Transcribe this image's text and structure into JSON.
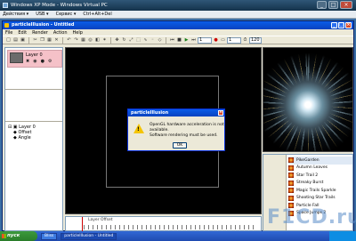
{
  "host": {
    "title": "Windows XP Mode - Windows Virtual PC",
    "menu": [
      "Действия ▾",
      "USB ▾",
      "Сервис ▾",
      "Ctrl+Alt+Del"
    ]
  },
  "app": {
    "title": "particleIllusion - Untitled",
    "menu": [
      "File",
      "Edit",
      "Render",
      "Action",
      "Help"
    ],
    "spin1": "1",
    "spin2": "1",
    "spin3": "120"
  },
  "layer": {
    "name": "Layer 0"
  },
  "tree": {
    "root": "Layer 0",
    "children": [
      "Offset",
      "Angle"
    ]
  },
  "timeline": {
    "label": "Layer Offset"
  },
  "emitters": {
    "items": [
      "PikeGarden",
      "Autumn Leaves",
      "Star Trail 2",
      "Streaky Burst",
      "Magic Trails Sparkle",
      "Shooting Star Trails",
      "Particle Fall",
      "Space Jumps 2"
    ],
    "selected_index": 0
  },
  "dialog": {
    "title": "particleIllusion",
    "line1": "OpenGL hardware acceleration is not available.",
    "line2": "Software rendering must be used.",
    "ok": "OK",
    "warn_glyph": "!"
  },
  "taskbar": {
    "start": "пуск",
    "tasks": [
      "Bliss",
      "particleIllusion - Untitled"
    ],
    "active_index": 1
  },
  "watermark": "F1CD.ru"
}
